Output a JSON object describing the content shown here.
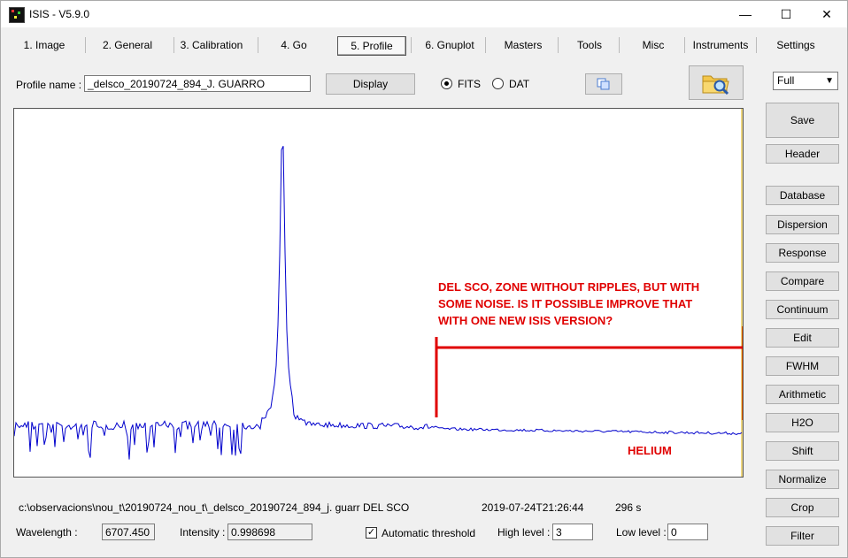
{
  "window": {
    "title": "ISIS - V5.9.0"
  },
  "tabs": [
    {
      "label": "1. Image"
    },
    {
      "label": "2. General"
    },
    {
      "label": "3. Calibration"
    },
    {
      "label": "4. Go"
    },
    {
      "label": "5. Profile"
    },
    {
      "label": "6. Gnuplot"
    },
    {
      "label": "Masters"
    },
    {
      "label": "Tools"
    },
    {
      "label": "Misc"
    },
    {
      "label": "Instruments"
    },
    {
      "label": "Settings"
    }
  ],
  "profile": {
    "name_label": "Profile name :",
    "name_value": "_delsco_20190724_894_J. GUARRO",
    "display_label": "Display",
    "fits_label": "FITS",
    "dat_label": "DAT",
    "format_selected": "FITS"
  },
  "zoom_select": {
    "value": "Full"
  },
  "right_buttons": {
    "save": "Save",
    "header": "Header",
    "database": "Database",
    "dispersion": "Dispersion",
    "response": "Response",
    "compare": "Compare",
    "continuum": "Continuum",
    "edit": "Edit",
    "fwhm": "FWHM",
    "arithmetic": "Arithmetic",
    "h2o": "H2O",
    "shift": "Shift",
    "normalize": "Normalize",
    "crop": "Crop",
    "filter": "Filter"
  },
  "annotation": {
    "line1": "DEL SCO, ZONE WITHOUT RIPPLES, BUT WITH",
    "line2": "SOME NOISE. IS IT POSSIBLE IMPROVE THAT",
    "line3": "WITH ONE NEW ISIS VERSION?",
    "helium": "HELIUM"
  },
  "status": {
    "path": "c:\\observacions\\nou_t\\20190724_nou_t\\_delsco_20190724_894_j. guarr DEL SCO",
    "datetime": "2019-07-24T21:26:44",
    "exposure": "296 s"
  },
  "bottom": {
    "wavelength_label": "Wavelength :",
    "wavelength_value": "6707.450",
    "intensity_label": "Intensity :",
    "intensity_value": "0.998698",
    "auto_threshold_label": "Automatic threshold",
    "auto_threshold_checked": true,
    "high_label": "High level :",
    "high_value": "3",
    "low_label": "Low level :",
    "low_value": "0"
  },
  "colors": {
    "spectrum": "#0000cc",
    "annotation": "#e00000"
  }
}
